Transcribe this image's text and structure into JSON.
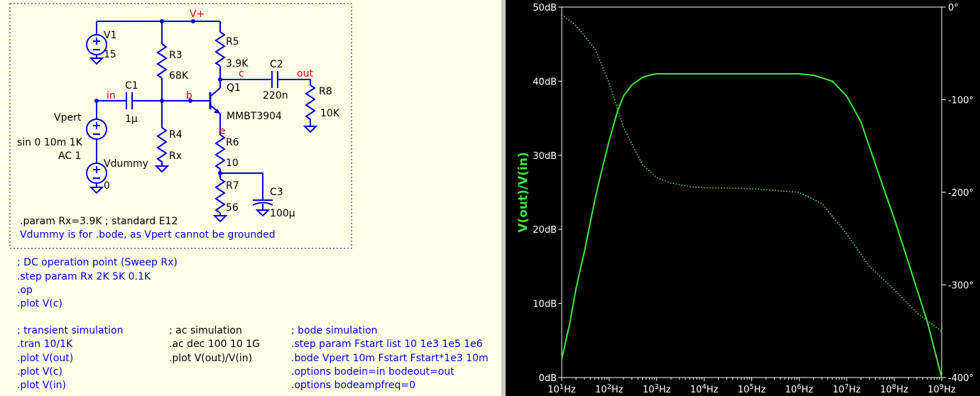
{
  "schematic": {
    "components": {
      "v1": {
        "name": "V1",
        "value": "15"
      },
      "r3": {
        "name": "R3",
        "value": "68K"
      },
      "r4": {
        "name": "R4",
        "value": "Rx"
      },
      "r5": {
        "name": "R5",
        "value": "3.9K"
      },
      "r6": {
        "name": "R6",
        "value": "10"
      },
      "r7": {
        "name": "R7",
        "value": "56"
      },
      "r8": {
        "name": "R8",
        "value": "10K"
      },
      "c1": {
        "name": "C1",
        "value": "1µ"
      },
      "c2": {
        "name": "C2",
        "value": "220n"
      },
      "c3": {
        "name": "C3",
        "value": "100µ"
      },
      "q1": {
        "name": "Q1",
        "value": "MMBT3904"
      },
      "vpert": {
        "name": "Vpert",
        "value1": "sin 0 10m 1K",
        "value2": "AC 1"
      },
      "vdummy": {
        "name": "Vdummy",
        "value": "0"
      }
    },
    "nets": {
      "vplus": "V+",
      "in": "in",
      "b": "b",
      "c": "c",
      "e": "e",
      "out": "out"
    },
    "directive_param": ".param Rx=3.9K ; standard E12",
    "comment_vdummy": "Vdummy is for .bode, as Vpert cannot be grounded",
    "dc_block": [
      "; DC operation point (Sweep Rx)",
      ".step param Rx 2K 5K 0.1K",
      ".op",
      ".plot V(c)"
    ],
    "tran_block": [
      "; transient simulation",
      ".tran 10/1K",
      ".plot V(out)",
      ".plot V(c)",
      ".plot V(in)"
    ],
    "ac_block": [
      "; ac simulation",
      ".ac dec 100 10 1G",
      ".plot V(out)/V(in)"
    ],
    "bode_block": [
      "; bode simulation",
      ".step param Fstart list 10 1e3 1e5 1e6",
      ".bode Vpert 10m Fstart Fstart*1e3 10m",
      ".options bodein=in bodeout=out",
      ".options bodeampfreq=0"
    ]
  },
  "chart_data": {
    "type": "line",
    "ylabel": "V(out)/V(in)",
    "x_scale": "log",
    "xlim": [
      10,
      1000000000
    ],
    "x_ticks": [
      {
        "v": 10,
        "m": "10",
        "e": "1"
      },
      {
        "v": 100,
        "m": "10",
        "e": "2"
      },
      {
        "v": 1000,
        "m": "10",
        "e": "3"
      },
      {
        "v": 10000,
        "m": "10",
        "e": "4"
      },
      {
        "v": 100000,
        "m": "10",
        "e": "5"
      },
      {
        "v": 1000000,
        "m": "10",
        "e": "6"
      },
      {
        "v": 10000000,
        "m": "10",
        "e": "7"
      },
      {
        "v": 100000000,
        "m": "10",
        "e": "8"
      },
      {
        "v": 1000000000,
        "m": "10",
        "e": "9"
      }
    ],
    "x_unit": "Hz",
    "ylim": [
      0,
      50
    ],
    "y_ticks": [
      "0dB",
      "10dB",
      "20dB",
      "30dB",
      "40dB",
      "50dB"
    ],
    "y2lim": [
      -400,
      0
    ],
    "y2_ticks": [
      "0°",
      "-100°",
      "-200°",
      "-300°",
      "-400°"
    ],
    "grid": false,
    "series": [
      {
        "style": "solid",
        "axis": "magnitude_dB",
        "color": "#3fe63f",
        "x": [
          10,
          15,
          20,
          30,
          50,
          70,
          100,
          150,
          200,
          300,
          500,
          700,
          1000,
          2000,
          5000,
          10000,
          100000,
          1000000,
          2000000,
          5000000,
          10000000,
          20000000,
          50000000,
          100000000,
          200000000,
          500000000,
          1000000000
        ],
        "y": [
          2.5,
          7.5,
          12,
          17,
          24,
          28,
          32,
          36,
          38,
          39.5,
          40.5,
          40.8,
          41,
          41,
          41,
          41,
          41,
          41,
          40.8,
          40,
          38,
          34.5,
          27,
          21.5,
          15.5,
          7.5,
          0
        ]
      },
      {
        "style": "dotted",
        "axis": "phase_deg",
        "color": "#3fe63f",
        "x": [
          10,
          20,
          50,
          100,
          200,
          500,
          1000,
          2000,
          5000,
          10000,
          100000,
          1000000,
          3000000,
          10000000,
          30000000,
          100000000,
          300000000,
          1000000000
        ],
        "y": [
          -8,
          -20,
          -45,
          -82,
          -130,
          -170,
          -184,
          -190,
          -194,
          -195,
          -196,
          -200,
          -212,
          -245,
          -280,
          -305,
          -330,
          -350
        ]
      }
    ]
  }
}
